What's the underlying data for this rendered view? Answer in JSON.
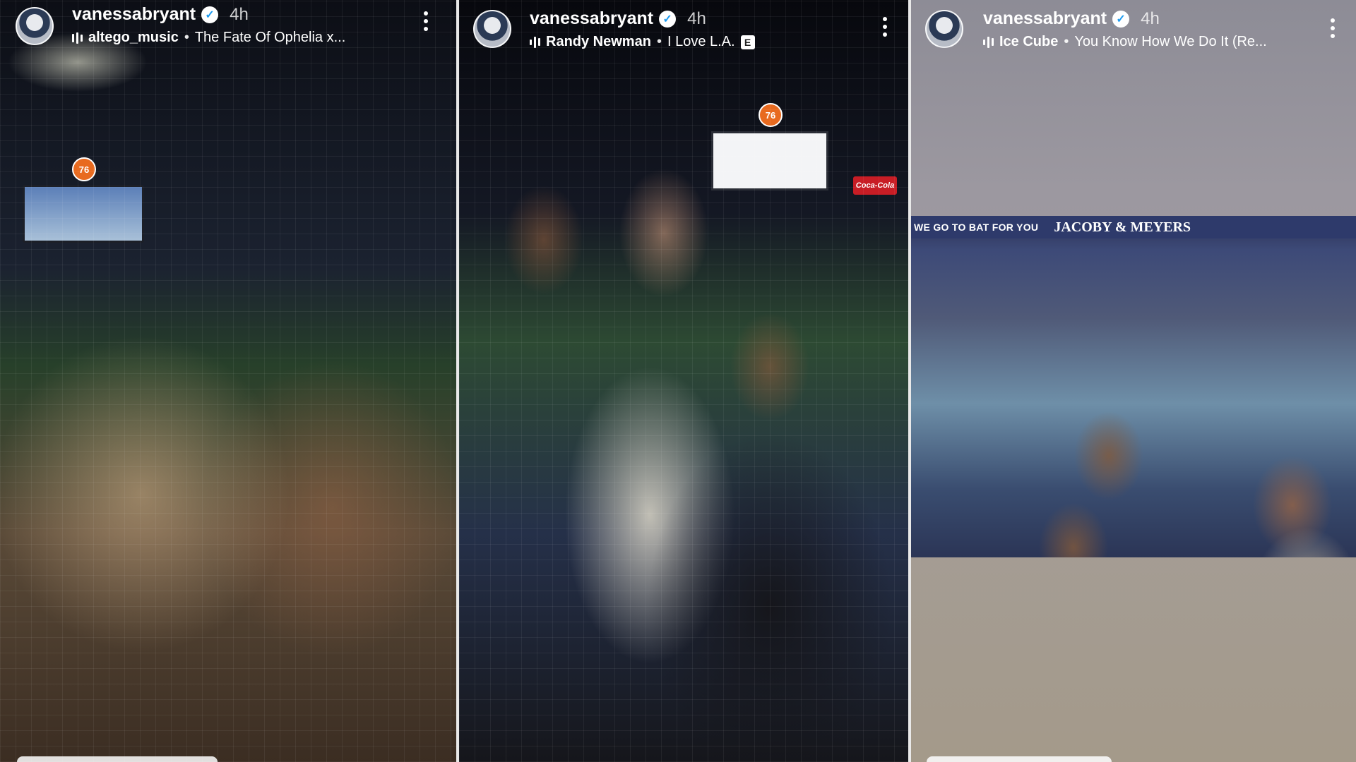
{
  "stories": [
    {
      "username": "vanessabryant",
      "time": "4h",
      "music_artist": "altego_music",
      "music_separator": "•",
      "music_title": "The Fate Of Ophelia x...",
      "explicit": ""
    },
    {
      "username": "vanessabryant",
      "time": "4h",
      "music_artist": "Randy Newman",
      "music_separator": "•",
      "music_title": "I Love L.A.",
      "explicit": "E"
    },
    {
      "username": "vanessabryant",
      "time": "4h",
      "music_artist": "Ice Cube",
      "music_separator": "•",
      "music_title": "You Know How We Do It (Re...",
      "explicit": ""
    }
  ],
  "signage": {
    "logo_76": "76",
    "coca_cola": "Coca-Cola",
    "banner_text": "WE GO TO BAT FOR YOU",
    "banner_brand": "JACOBY & MEYERS"
  },
  "icons": {
    "verified": "verified-check-icon",
    "music": "music-equalizer-icon",
    "more": "more-vertical-icon"
  },
  "colors": {
    "verified_blue": "#1d9bf0",
    "dodgers_blue": "#2e3a6b",
    "coca_cola_red": "#c81d25",
    "logo_76_orange": "#e86a1f"
  }
}
